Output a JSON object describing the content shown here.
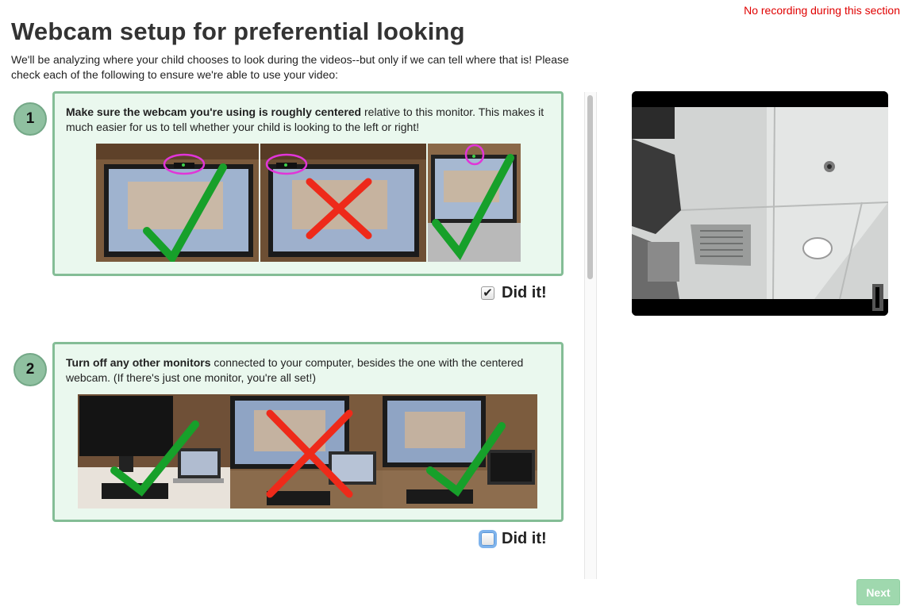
{
  "recording_status": "No recording during this section",
  "title": "Webcam setup for preferential looking",
  "intro": "We'll be analyzing where your child chooses to look during the videos--but only if we can tell where that is! Please check each of the following to ensure we're able to use your video:",
  "steps": [
    {
      "number": "1",
      "bold": "Make sure the webcam you're using is roughly centered",
      "text": " relative to this monitor. This makes it much easier for us to tell whether your child is looking to the left or right!",
      "photos": [
        "check",
        "cross",
        "check"
      ],
      "did_it_label": "Did it!",
      "checked": true
    },
    {
      "number": "2",
      "bold": "Turn off any other monitors",
      "text": " connected to your computer, besides the one with the centered webcam. (If there's just one monitor, you're all set!)",
      "photos": [
        "check",
        "cross",
        "check"
      ],
      "did_it_label": "Did it!",
      "checked": false
    }
  ],
  "next_label": "Next",
  "colors": {
    "accent_green": "#84bd96",
    "card_bg": "#eaf8ee",
    "status_red": "#e00000",
    "next_bg": "#9fd8ae"
  }
}
